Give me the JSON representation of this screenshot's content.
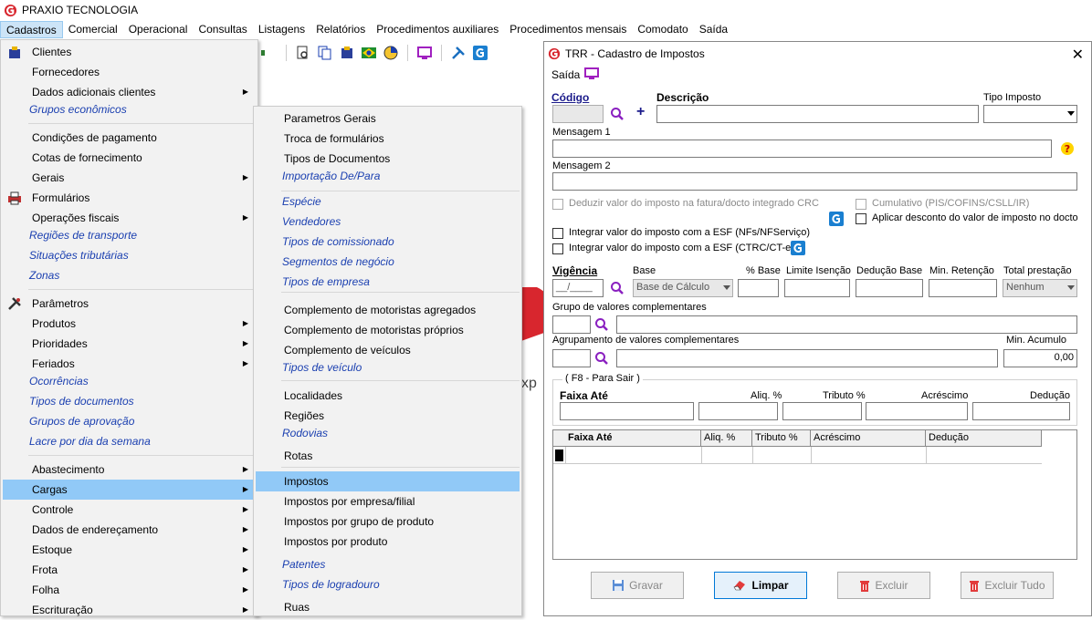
{
  "app": {
    "title": "PRAXIO TECNOLOGIA"
  },
  "menubar": [
    "Cadastros",
    "Comercial",
    "Operacional",
    "Consultas",
    "Listagens",
    "Relatórios",
    "Procedimentos auxiliares",
    "Procedimentos mensais",
    "Comodato",
    "Saída"
  ],
  "menu1": [
    {
      "label": "Clientes",
      "icon": "clients-icon"
    },
    {
      "label": "Fornecedores"
    },
    {
      "label": "Dados adicionais clientes",
      "submenu": true
    },
    {
      "label": "Grupos econômicos",
      "italic": true
    },
    {
      "label": "Condições de pagamento"
    },
    {
      "label": "Cotas de fornecimento"
    },
    {
      "label": "Gerais",
      "submenu": true
    },
    {
      "label": "Formulários",
      "icon": "printer-icon"
    },
    {
      "label": "Operações fiscais",
      "submenu": true
    },
    {
      "label": "Regiões de transporte",
      "italic": true
    },
    {
      "label": "Situações tributárias",
      "italic": true
    },
    {
      "label": "Zonas",
      "italic": true
    },
    {
      "label": "Parâmetros",
      "icon": "tools-icon"
    },
    {
      "label": "Produtos",
      "submenu": true
    },
    {
      "label": "Prioridades",
      "submenu": true
    },
    {
      "label": "Feriados",
      "submenu": true
    },
    {
      "label": "Ocorrências",
      "italic": true
    },
    {
      "label": "Tipos de documentos",
      "italic": true
    },
    {
      "label": "Grupos de aprovação",
      "italic": true
    },
    {
      "label": "Lacre por dia da semana",
      "italic": true
    },
    {
      "label": "Abastecimento",
      "submenu": true
    },
    {
      "label": "Cargas",
      "submenu": true,
      "highlight": true
    },
    {
      "label": "Controle",
      "submenu": true
    },
    {
      "label": "Dados de endereçamento",
      "submenu": true
    },
    {
      "label": "Estoque",
      "submenu": true
    },
    {
      "label": "Frota",
      "submenu": true
    },
    {
      "label": "Folha",
      "submenu": true
    },
    {
      "label": "Escrituração",
      "submenu": true
    }
  ],
  "menu2": [
    {
      "label": "Parametros Gerais"
    },
    {
      "label": "Troca de formulários"
    },
    {
      "label": "Tipos de Documentos"
    },
    {
      "label": "Importação De/Para",
      "italic": true
    },
    {
      "label": "Espécie",
      "italic": true
    },
    {
      "label": "Vendedores",
      "italic": true
    },
    {
      "label": "Tipos de  comissionado",
      "italic": true
    },
    {
      "label": "Segmentos de negócio",
      "italic": true
    },
    {
      "label": "Tipos de empresa",
      "italic": true
    },
    {
      "label": "Complemento de motoristas agregados"
    },
    {
      "label": "Complemento de motoristas próprios"
    },
    {
      "label": "Complemento de veículos"
    },
    {
      "label": "Tipos de veículo",
      "italic": true
    },
    {
      "label": "Localidades"
    },
    {
      "label": "Regiões"
    },
    {
      "label": "Rodovias",
      "italic": true
    },
    {
      "label": "Rotas"
    },
    {
      "label": "Impostos",
      "highlight": true
    },
    {
      "label": "Impostos por empresa/filial"
    },
    {
      "label": "Impostos por grupo de produto"
    },
    {
      "label": "Impostos por produto"
    },
    {
      "label": "Patentes",
      "italic": true
    },
    {
      "label": "Tipos de logradouro",
      "italic": true
    },
    {
      "label": "Ruas"
    }
  ],
  "bg_text": "xp",
  "window": {
    "title": "TRR - Cadastro de Impostos",
    "saida": "Saída",
    "codigo": "Código",
    "descricao": "Descrição",
    "tipo_imposto": "Tipo Imposto",
    "mensagem1": "Mensagem 1",
    "mensagem2": "Mensagem 2",
    "deduzir": "Deduzir valor do imposto na fatura/docto integrado CRC",
    "cumulativo": "Cumulativo (PIS/COFINS/CSLL/IR)",
    "aplicar": "Aplicar desconto do valor de imposto no docto",
    "integrar_nfs": "Integrar valor do imposto com a ESF (NFs/NFServiço)",
    "integrar_ctrc": "Integrar valor do imposto com a ESF (CTRC/CT-e)",
    "vigencia": "Vigência",
    "vigencia_value": "__/____",
    "base": "Base",
    "base_value": "Base de Cálculo",
    "pct_base": "% Base",
    "limite": "Limite Isenção",
    "deducao_base": "Dedução Base",
    "min_retencao": "Min. Retenção",
    "total_prestacao": "Total prestação",
    "total_prestacao_value": "Nenhum",
    "grupo_valores": "Grupo de valores complementares",
    "agrupamento": "Agrupamento de valores complementares",
    "min_acumulo": "Min. Acumulo",
    "min_acumulo_value": "0,00",
    "f8": "( F8 - Para Sair )",
    "faixa_ate": "Faixa Até",
    "aliq": "Aliq. %",
    "tributo": "Tributo %",
    "acrescimo": "Acréscimo",
    "deducao": "Dedução",
    "grid_cols": [
      "Faixa Até",
      "Aliq. %",
      "Tributo %",
      "Acréscimo",
      "Dedução"
    ],
    "btn_gravar": "Gravar",
    "btn_limpar": "Limpar",
    "btn_excluir": "Excluir",
    "btn_excluir_tudo": "Excluir Tudo"
  }
}
